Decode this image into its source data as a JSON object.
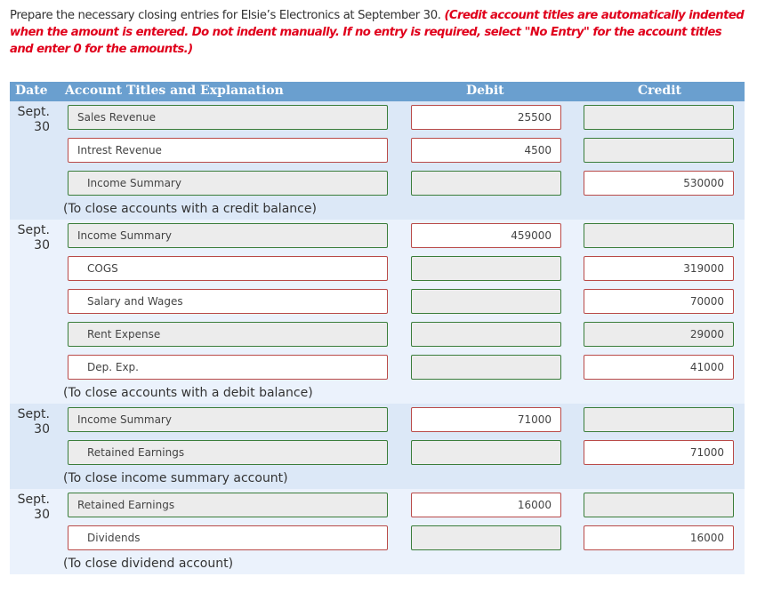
{
  "instructions": {
    "text": "Prepare the necessary closing entries for Elsie’s Electronics at September 30. ",
    "note": "(Credit account titles are automatically indented when the amount is entered. Do not indent manually. If no entry is required, select \"No Entry\" for the account titles and enter 0 for the amounts.)"
  },
  "table": {
    "headers": {
      "date": "Date",
      "account": "Account Titles and Explanation",
      "debit": "Debit",
      "credit": "Credit"
    },
    "entries": [
      {
        "date_month": "Sept.",
        "date_day": "30",
        "lines": [
          {
            "account": "Sales Revenue",
            "account_status": "correct",
            "indent": false,
            "debit": "25500",
            "debit_status": "incorrect",
            "credit": "",
            "credit_status": "correct"
          },
          {
            "account": "Intrest Revenue",
            "account_status": "incorrect",
            "indent": false,
            "debit": "4500",
            "debit_status": "incorrect",
            "credit": "",
            "credit_status": "correct"
          },
          {
            "account": "Income Summary",
            "account_status": "correct",
            "indent": true,
            "debit": "",
            "debit_status": "correct",
            "credit": "530000",
            "credit_status": "incorrect"
          }
        ],
        "explanation": "(To close accounts with a credit balance)"
      },
      {
        "date_month": "Sept.",
        "date_day": "30",
        "lines": [
          {
            "account": "Income Summary",
            "account_status": "correct",
            "indent": false,
            "debit": "459000",
            "debit_status": "incorrect",
            "credit": "",
            "credit_status": "correct"
          },
          {
            "account": "COGS",
            "account_status": "incorrect",
            "indent": true,
            "debit": "",
            "debit_status": "correct",
            "credit": "319000",
            "credit_status": "incorrect"
          },
          {
            "account": "Salary and Wages",
            "account_status": "incorrect",
            "indent": true,
            "debit": "",
            "debit_status": "correct",
            "credit": "70000",
            "credit_status": "incorrect"
          },
          {
            "account": "Rent Expense",
            "account_status": "correct",
            "indent": true,
            "debit": "",
            "debit_status": "correct",
            "credit": "29000",
            "credit_status": "correct"
          },
          {
            "account": "Dep. Exp.",
            "account_status": "incorrect",
            "indent": true,
            "debit": "",
            "debit_status": "correct",
            "credit": "41000",
            "credit_status": "incorrect"
          }
        ],
        "explanation": "(To close accounts with a debit balance)"
      },
      {
        "date_month": "Sept.",
        "date_day": "30",
        "lines": [
          {
            "account": "Income Summary",
            "account_status": "correct",
            "indent": false,
            "debit": "71000",
            "debit_status": "incorrect",
            "credit": "",
            "credit_status": "correct"
          },
          {
            "account": "Retained Earnings",
            "account_status": "correct",
            "indent": true,
            "debit": "",
            "debit_status": "correct",
            "credit": "71000",
            "credit_status": "incorrect"
          }
        ],
        "explanation": "(To close income summary account)"
      },
      {
        "date_month": "Sept.",
        "date_day": "30",
        "lines": [
          {
            "account": "Retained Earnings",
            "account_status": "correct",
            "indent": false,
            "debit": "16000",
            "debit_status": "incorrect",
            "credit": "",
            "credit_status": "correct"
          },
          {
            "account": "Dividends",
            "account_status": "incorrect",
            "indent": true,
            "debit": "",
            "debit_status": "correct",
            "credit": "16000",
            "credit_status": "incorrect"
          }
        ],
        "explanation": "(To close dividend account)"
      }
    ]
  },
  "colors": {
    "header_bg": "#6a9fcf",
    "block_dark": "#dce8f7",
    "block_light": "#ebf2fc",
    "correct_border": "#3a7d3a",
    "incorrect_border": "#b94a48",
    "note_red": "#e0001b"
  }
}
